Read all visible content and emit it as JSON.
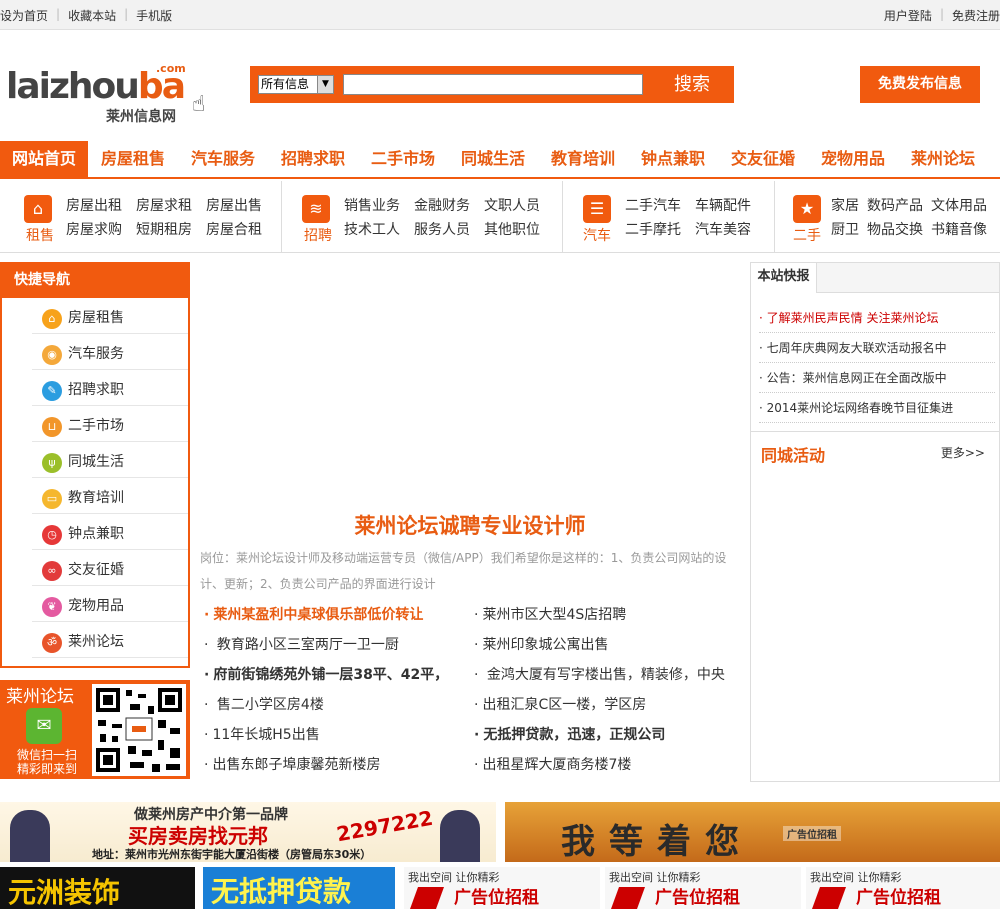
{
  "topbar": {
    "set_home": "设为首页",
    "bookmark": "收藏本站",
    "mobile": "手机版",
    "login": "用户登陆",
    "register": "免费注册"
  },
  "logo": {
    "main": "laizhouba",
    "com": ".com",
    "sub": "莱州信息网",
    "icon": "hand-pointer-icon"
  },
  "search": {
    "category": "所有信息",
    "value": "",
    "button": "搜索"
  },
  "publish_button": "免费发布信息",
  "nav": [
    "网站首页",
    "房屋租售",
    "汽车服务",
    "招聘求职",
    "二手市场",
    "同城生活",
    "教育培训",
    "钟点兼职",
    "交友征婚",
    "宠物用品",
    "莱州论坛"
  ],
  "categories": [
    {
      "label": "租售",
      "icon": "home-icon",
      "links": [
        "房屋出租",
        "房屋求租",
        "房屋出售",
        "房屋求购",
        "短期租房",
        "房屋合租"
      ]
    },
    {
      "label": "招聘",
      "icon": "layers-icon",
      "links": [
        "销售业务",
        "金融财务",
        "文职人员",
        "技术工人",
        "服务人员",
        "其他职位"
      ]
    },
    {
      "label": "汽车",
      "icon": "list-icon",
      "links": [
        "二手汽车",
        "车辆配件",
        "二手摩托",
        "汽车美容"
      ]
    },
    {
      "label": "二手",
      "icon": "star-icon",
      "links": [
        "家居",
        "数码产品",
        "文体用品",
        "厨卫",
        "物品交换",
        "书籍音像"
      ]
    }
  ],
  "sidebar": {
    "title": "快捷导航",
    "items": [
      {
        "label": "房屋租售",
        "icon": "house-icon",
        "color": "#f7a21b"
      },
      {
        "label": "汽车服务",
        "icon": "car-icon",
        "color": "#f4a83a"
      },
      {
        "label": "招聘求职",
        "icon": "pen-icon",
        "color": "#2b9de0"
      },
      {
        "label": "二手市场",
        "icon": "cart-icon",
        "color": "#f2962a"
      },
      {
        "label": "同城生活",
        "icon": "cutlery-icon",
        "color": "#9bbf2a"
      },
      {
        "label": "教育培训",
        "icon": "board-icon",
        "color": "#f5b72e"
      },
      {
        "label": "钟点兼职",
        "icon": "clock-icon",
        "color": "#e63838"
      },
      {
        "label": "交友征婚",
        "icon": "rings-icon",
        "color": "#e23b3b"
      },
      {
        "label": "宠物用品",
        "icon": "paw-icon",
        "color": "#e45aa0"
      },
      {
        "label": "莱州论坛",
        "icon": "om-icon",
        "color": "#e8542a"
      }
    ]
  },
  "qr": {
    "title": "莱州论坛",
    "caption": "微信扫一扫 精彩即来到"
  },
  "center": {
    "headline": "莱州论坛诚聘专业设计师",
    "description": "岗位：莱州论坛设计师及移动端运营专员（微信/APP）我们希望你是这样的：1、负责公司网站的设计、更新；2、负责公司产品的界面进行设计",
    "news": [
      "莱州某盈利中桌球俱乐部低价转让",
      "莱州市区大型4S店招聘",
      "教育路小区三室两厅一卫一厨",
      "莱州印象城公寓出售",
      "府前街锦绣苑外铺一层38平、42平，",
      "金鸿大厦有写字楼出售，精装修，中央",
      "售二小学区房4楼",
      "出租汇泉C区一楼，学区房",
      "11年长城H5出售",
      "无抵押贷款，迅速，正规公司",
      "出售东郎子埠康馨苑新楼房",
      "出租星辉大厦商务楼7楼"
    ]
  },
  "right": {
    "tab": "本站快报",
    "news": [
      "了解莱州民声民情 关注莱州论坛",
      "七周年庆典网友大联欢活动报名中",
      "公告：莱州信息网正在全面改版中",
      "2014莱州论坛网络春晚节目征集进"
    ],
    "activity_title": "同城活动",
    "more": "更多>>"
  },
  "banners": {
    "b1_top": "做莱州房产中介第一品牌",
    "b1_main": "买房卖房找元邦",
    "b1_addr": "地址：莱州市光州东街宇能大厦沿街楼（房管局东30米）",
    "b1_phone": "2297222",
    "b2_main": "我等着您",
    "b2_sub": "广告位招租",
    "b3": "元洲装饰",
    "b4": "无抵押贷款",
    "ad_top": "我出空间 让你精彩",
    "ad_main": "广告位招租"
  },
  "colors": {
    "accent": "#f15a0f",
    "accent_text": "#e85c12"
  }
}
